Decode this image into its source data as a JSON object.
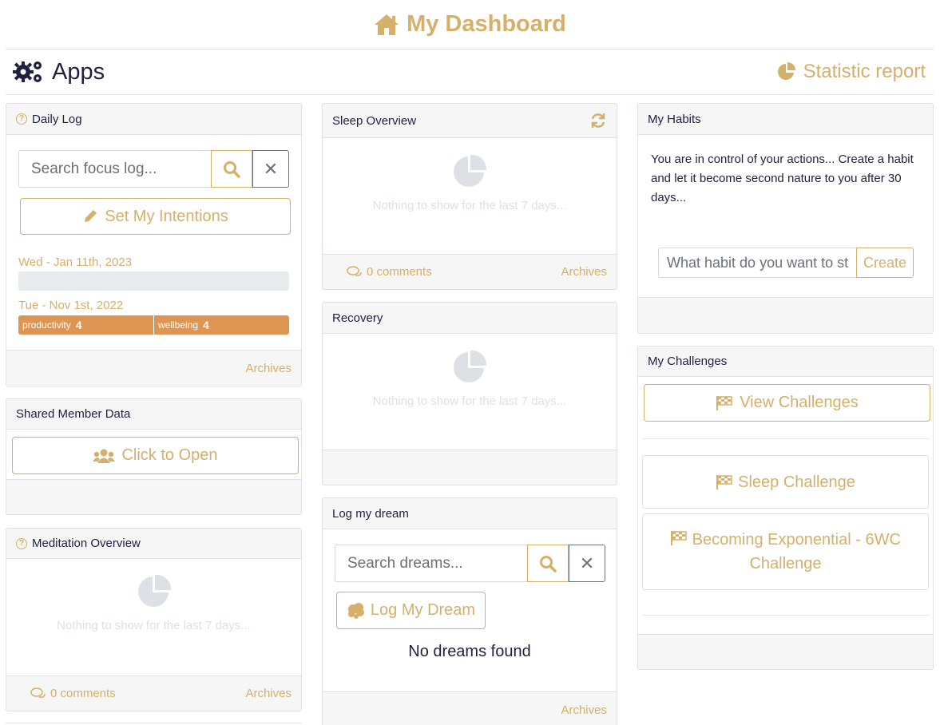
{
  "header": {
    "title": "My Dashboard",
    "icon": "home-icon"
  },
  "apps": {
    "title": "Apps",
    "icon": "cogs-icon",
    "stat_link": "Statistic report"
  },
  "daily_log": {
    "title": "Daily Log",
    "search_placeholder": "Search focus log...",
    "intentions_button": "Set My Intentions",
    "entries": [
      {
        "date": "Wed - Jan 11th, 2023"
      },
      {
        "date": "Tue - Nov 1st, 2022",
        "tags": [
          {
            "label": "productivity",
            "value": "4"
          },
          {
            "label": "wellbeing",
            "value": "4"
          }
        ]
      }
    ],
    "archives": "Archives"
  },
  "shared_member": {
    "title": "Shared Member Data",
    "open_button": "Click to Open"
  },
  "meditation": {
    "title": "Meditation Overview",
    "empty": "Nothing to show for the last 7 days...",
    "comments": "0 comments",
    "archives": "Archives"
  },
  "sleep": {
    "title": "Sleep Overview",
    "empty": "Nothing to show for the last 7 days...",
    "comments": "0 comments",
    "archives": "Archives"
  },
  "recovery": {
    "title": "Recovery",
    "empty": "Nothing to show for the last 7 days..."
  },
  "dream": {
    "title": "Log my dream",
    "search_placeholder": "Search dreams...",
    "log_button": "Log My Dream",
    "empty": "No dreams found",
    "archives": "Archives"
  },
  "habits": {
    "title": "My Habits",
    "description": "You are in control of your actions... Create a habit and let it become second nature to you after 30 days...",
    "input_placeholder": "What habit do you want to st",
    "create_button": "Create"
  },
  "challenges": {
    "title": "My Challenges",
    "view_button": "View Challenges",
    "items": [
      "Sleep Challenge",
      "Becoming Exponential - 6WC Challenge"
    ]
  },
  "colors": {
    "accent": "#d4b06a",
    "navy": "#1f2040",
    "tag_orange": "#df9552"
  }
}
